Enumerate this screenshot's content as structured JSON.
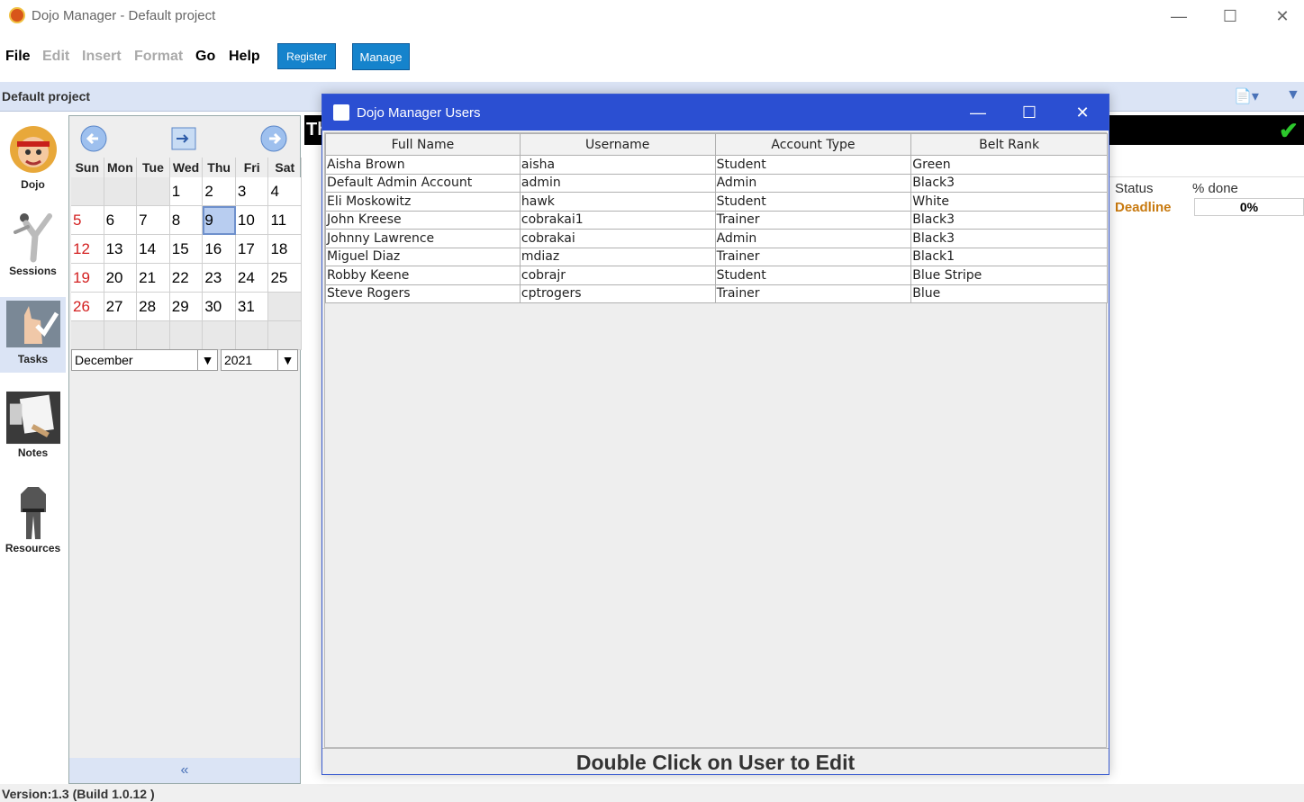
{
  "window": {
    "title": "Dojo Manager - Default project"
  },
  "menu": {
    "file": "File",
    "edit": "Edit",
    "insert": "Insert",
    "format": "Format",
    "go": "Go",
    "help": "Help",
    "register": "Register",
    "manage": "Manage"
  },
  "project": {
    "name": "Default project"
  },
  "sidebar": {
    "items": [
      {
        "label": "Dojo"
      },
      {
        "label": "Sessions"
      },
      {
        "label": "Tasks"
      },
      {
        "label": "Notes"
      },
      {
        "label": "Resources"
      }
    ]
  },
  "calendar": {
    "weekdays": [
      "Sun",
      "Mon",
      "Tue",
      "Wed",
      "Thu",
      "Fri",
      "Sat"
    ],
    "weeks": [
      [
        "",
        "",
        "",
        "1",
        "2",
        "3",
        "4"
      ],
      [
        "5",
        "6",
        "7",
        "8",
        "9",
        "10",
        "11"
      ],
      [
        "12",
        "13",
        "14",
        "15",
        "16",
        "17",
        "18"
      ],
      [
        "19",
        "20",
        "21",
        "22",
        "23",
        "24",
        "25"
      ],
      [
        "26",
        "27",
        "28",
        "29",
        "30",
        "31",
        ""
      ],
      [
        "",
        "",
        "",
        "",
        "",
        "",
        ""
      ]
    ],
    "selected_day": "9",
    "month": "December",
    "year": "2021"
  },
  "main": {
    "banner_text": "Th",
    "status_header": "Status",
    "done_header": "% done",
    "deadline_label": "Deadline",
    "percent_done": "0%"
  },
  "dialog": {
    "title": "Dojo Manager Users",
    "columns": [
      "Full Name",
      "Username",
      "Account Type",
      "Belt Rank"
    ],
    "rows": [
      [
        "Aisha Brown",
        "aisha",
        "Student",
        "Green"
      ],
      [
        "Default Admin Account",
        "admin",
        "Admin",
        "Black3"
      ],
      [
        "Eli Moskowitz",
        "hawk",
        "Student",
        "White"
      ],
      [
        "John Kreese",
        "cobrakai1",
        "Trainer",
        "Black3"
      ],
      [
        "Johnny Lawrence",
        "cobrakai",
        "Admin",
        "Black3"
      ],
      [
        "Miguel Diaz",
        "mdiaz",
        "Trainer",
        "Black1"
      ],
      [
        "Robby Keene",
        "cobrajr",
        "Student",
        "Blue Stripe"
      ],
      [
        "Steve Rogers",
        "cptrogers",
        "Trainer",
        "Blue"
      ]
    ],
    "footer": "Double Click on User to Edit"
  },
  "status": {
    "version": "Version:1.3 (Build 1.0.12 )"
  },
  "colors": {
    "dialog_title_bg": "#2b4fd2",
    "button_bg": "#1583cc",
    "project_bar_bg": "#dbe4f5",
    "sunday_red": "#d32020",
    "deadline_orange": "#c87a10"
  },
  "icons": {
    "prev_month": "arrow-left-icon",
    "today": "calendar-today-icon",
    "next_month": "arrow-right-icon",
    "collapse": "double-chevron-left-icon",
    "checkmark": "checkmark-icon"
  }
}
